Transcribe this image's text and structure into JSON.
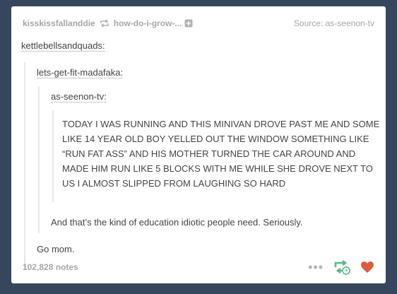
{
  "post": {
    "reblogger": "kisskissfallanddie",
    "reblogged_from": "how-do-i-grow-...",
    "source_label": "Source:",
    "source_blog": "as-seenon-tv",
    "quotes": [
      {
        "user": "kettlebellsandquads:",
        "comment": "Go mom."
      },
      {
        "user": "lets-get-fit-madafaka:",
        "comment": "And that’s the kind of education idiotic people need. Seriously."
      },
      {
        "user": "as-seenon-tv:",
        "text": "TODAY I WAS RUNNING AND THIS MINIVAN DROVE PAST ME AND SOME LIKE 14 YEAR OLD BOY YELLED OUT THE WINDOW SOMETHING LIKE “RUN FAT ASS” AND HIS MOTHER TURNED THE CAR AROUND AND MADE HIM RUN LIKE 5 BLOCKS WITH ME WHILE SHE DROVE NEXT TO US I ALMOST SLIPPED FROM LAUGHING SO HARD"
      }
    ],
    "notes": "102,828 notes"
  },
  "icons": {
    "reblog_small": "reblog-icon",
    "follow": "plus-square-icon",
    "more": "more-dots-icon",
    "reblog": "reblog-icon",
    "like": "heart-icon"
  },
  "colors": {
    "background": "#36465d",
    "card": "#ffffff",
    "meta_text": "#a7a7a7",
    "body_text": "#444444",
    "reblog_green": "#56bc8a",
    "heart_red": "#d95e40"
  }
}
